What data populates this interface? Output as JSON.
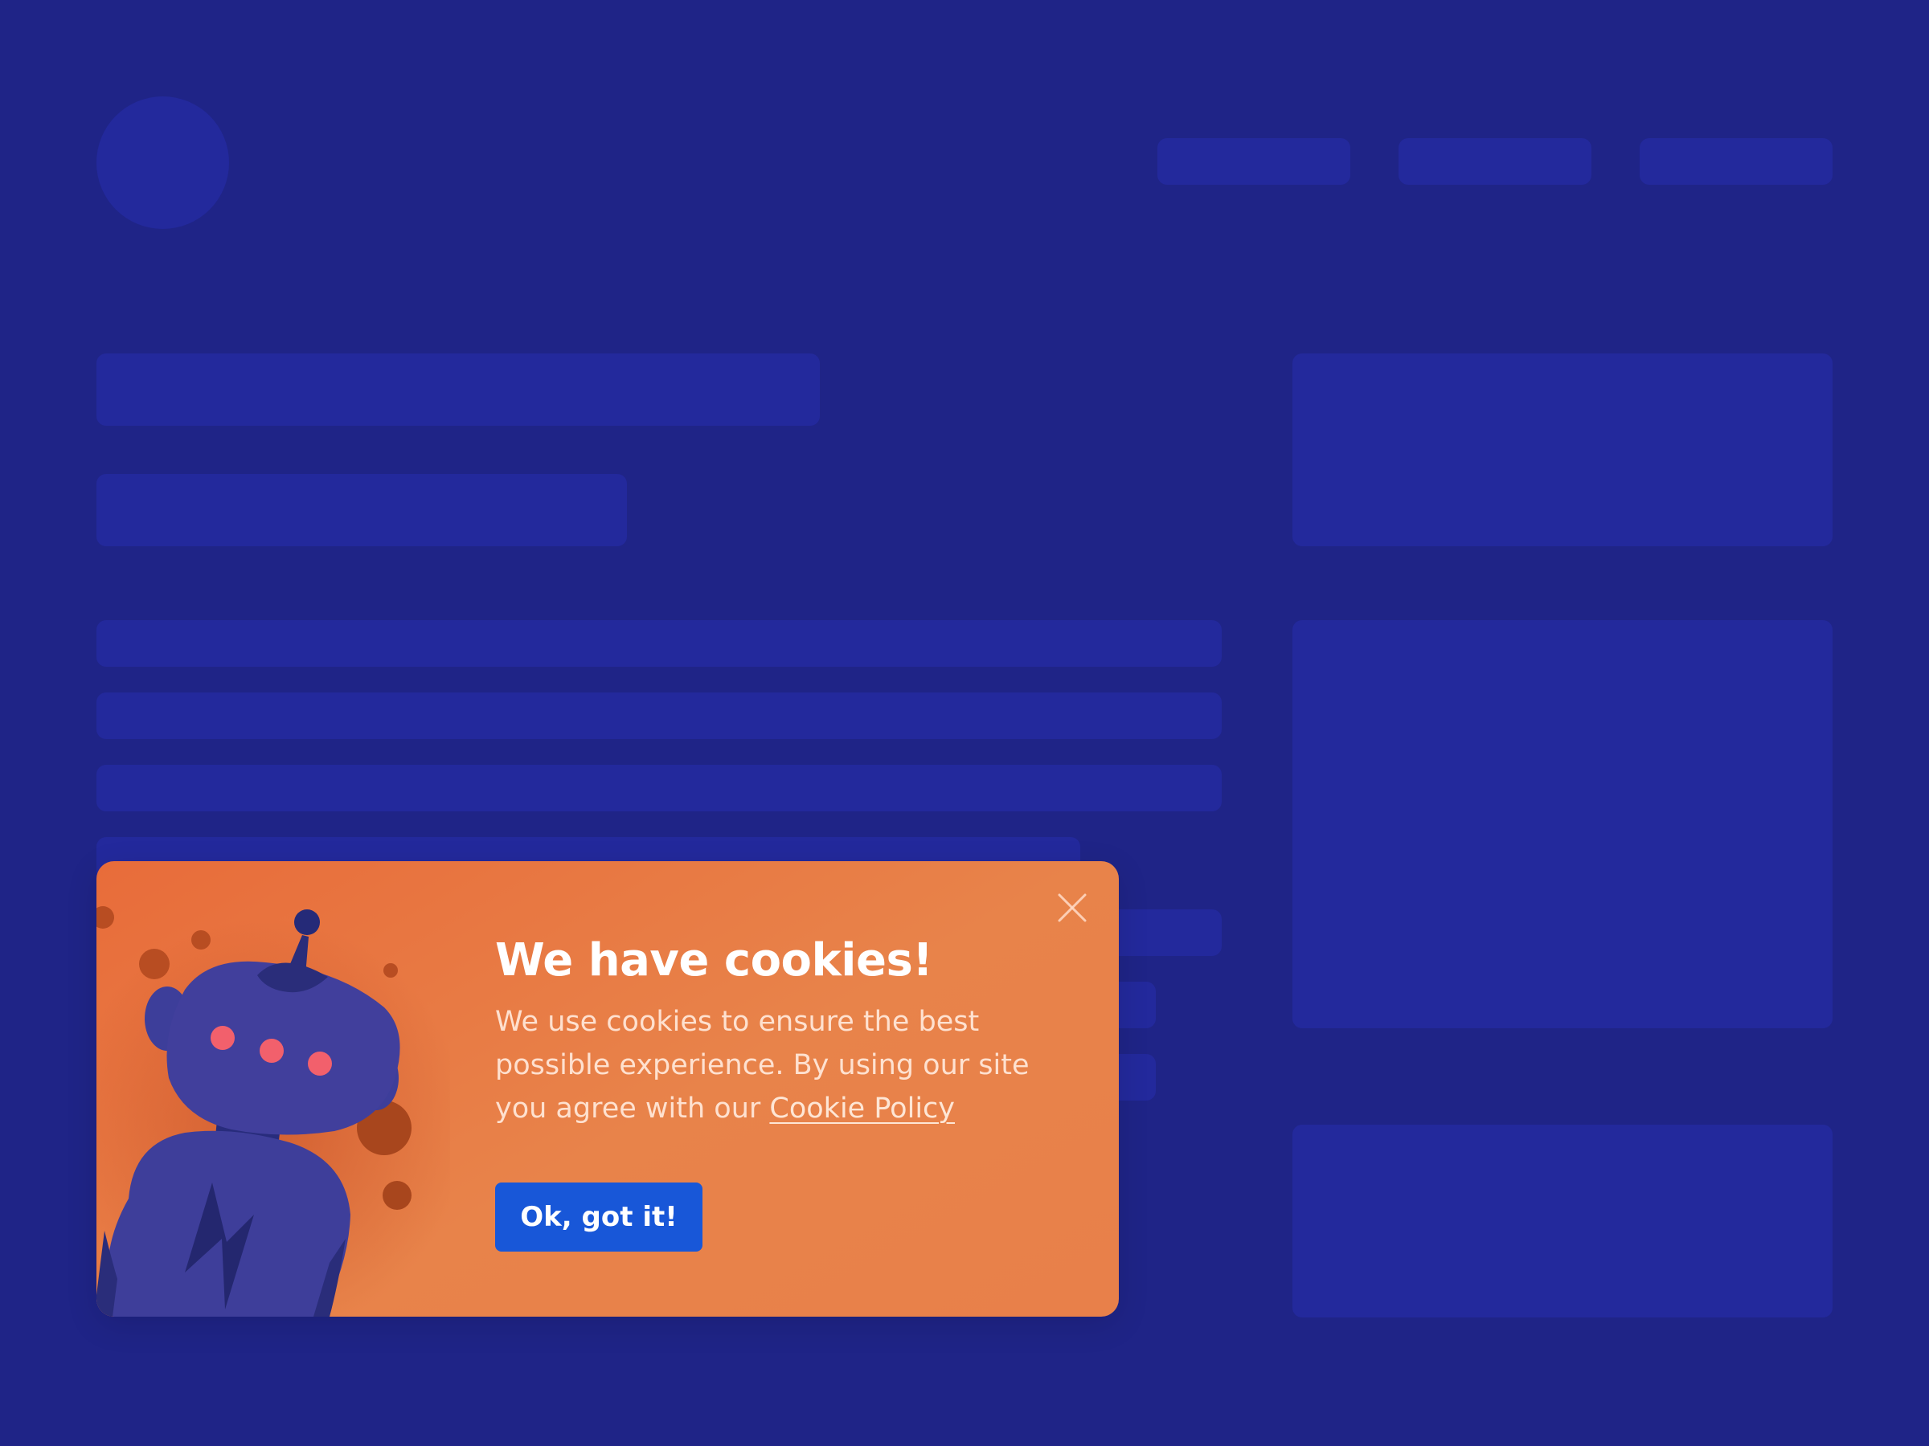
{
  "cookie_banner": {
    "title": "We have cookies!",
    "message_text": "We use cookies to ensure the best possible experience. By using our site you agree with our ",
    "policy_link": "Cookie Policy",
    "accept_button": "Ok, got it!",
    "close_icon": "close-icon",
    "illustration": "robot-illustration"
  },
  "colors": {
    "background": "#1f2487",
    "placeholder": "#23299c",
    "banner": "#e8834a",
    "button": "#1857d8"
  }
}
